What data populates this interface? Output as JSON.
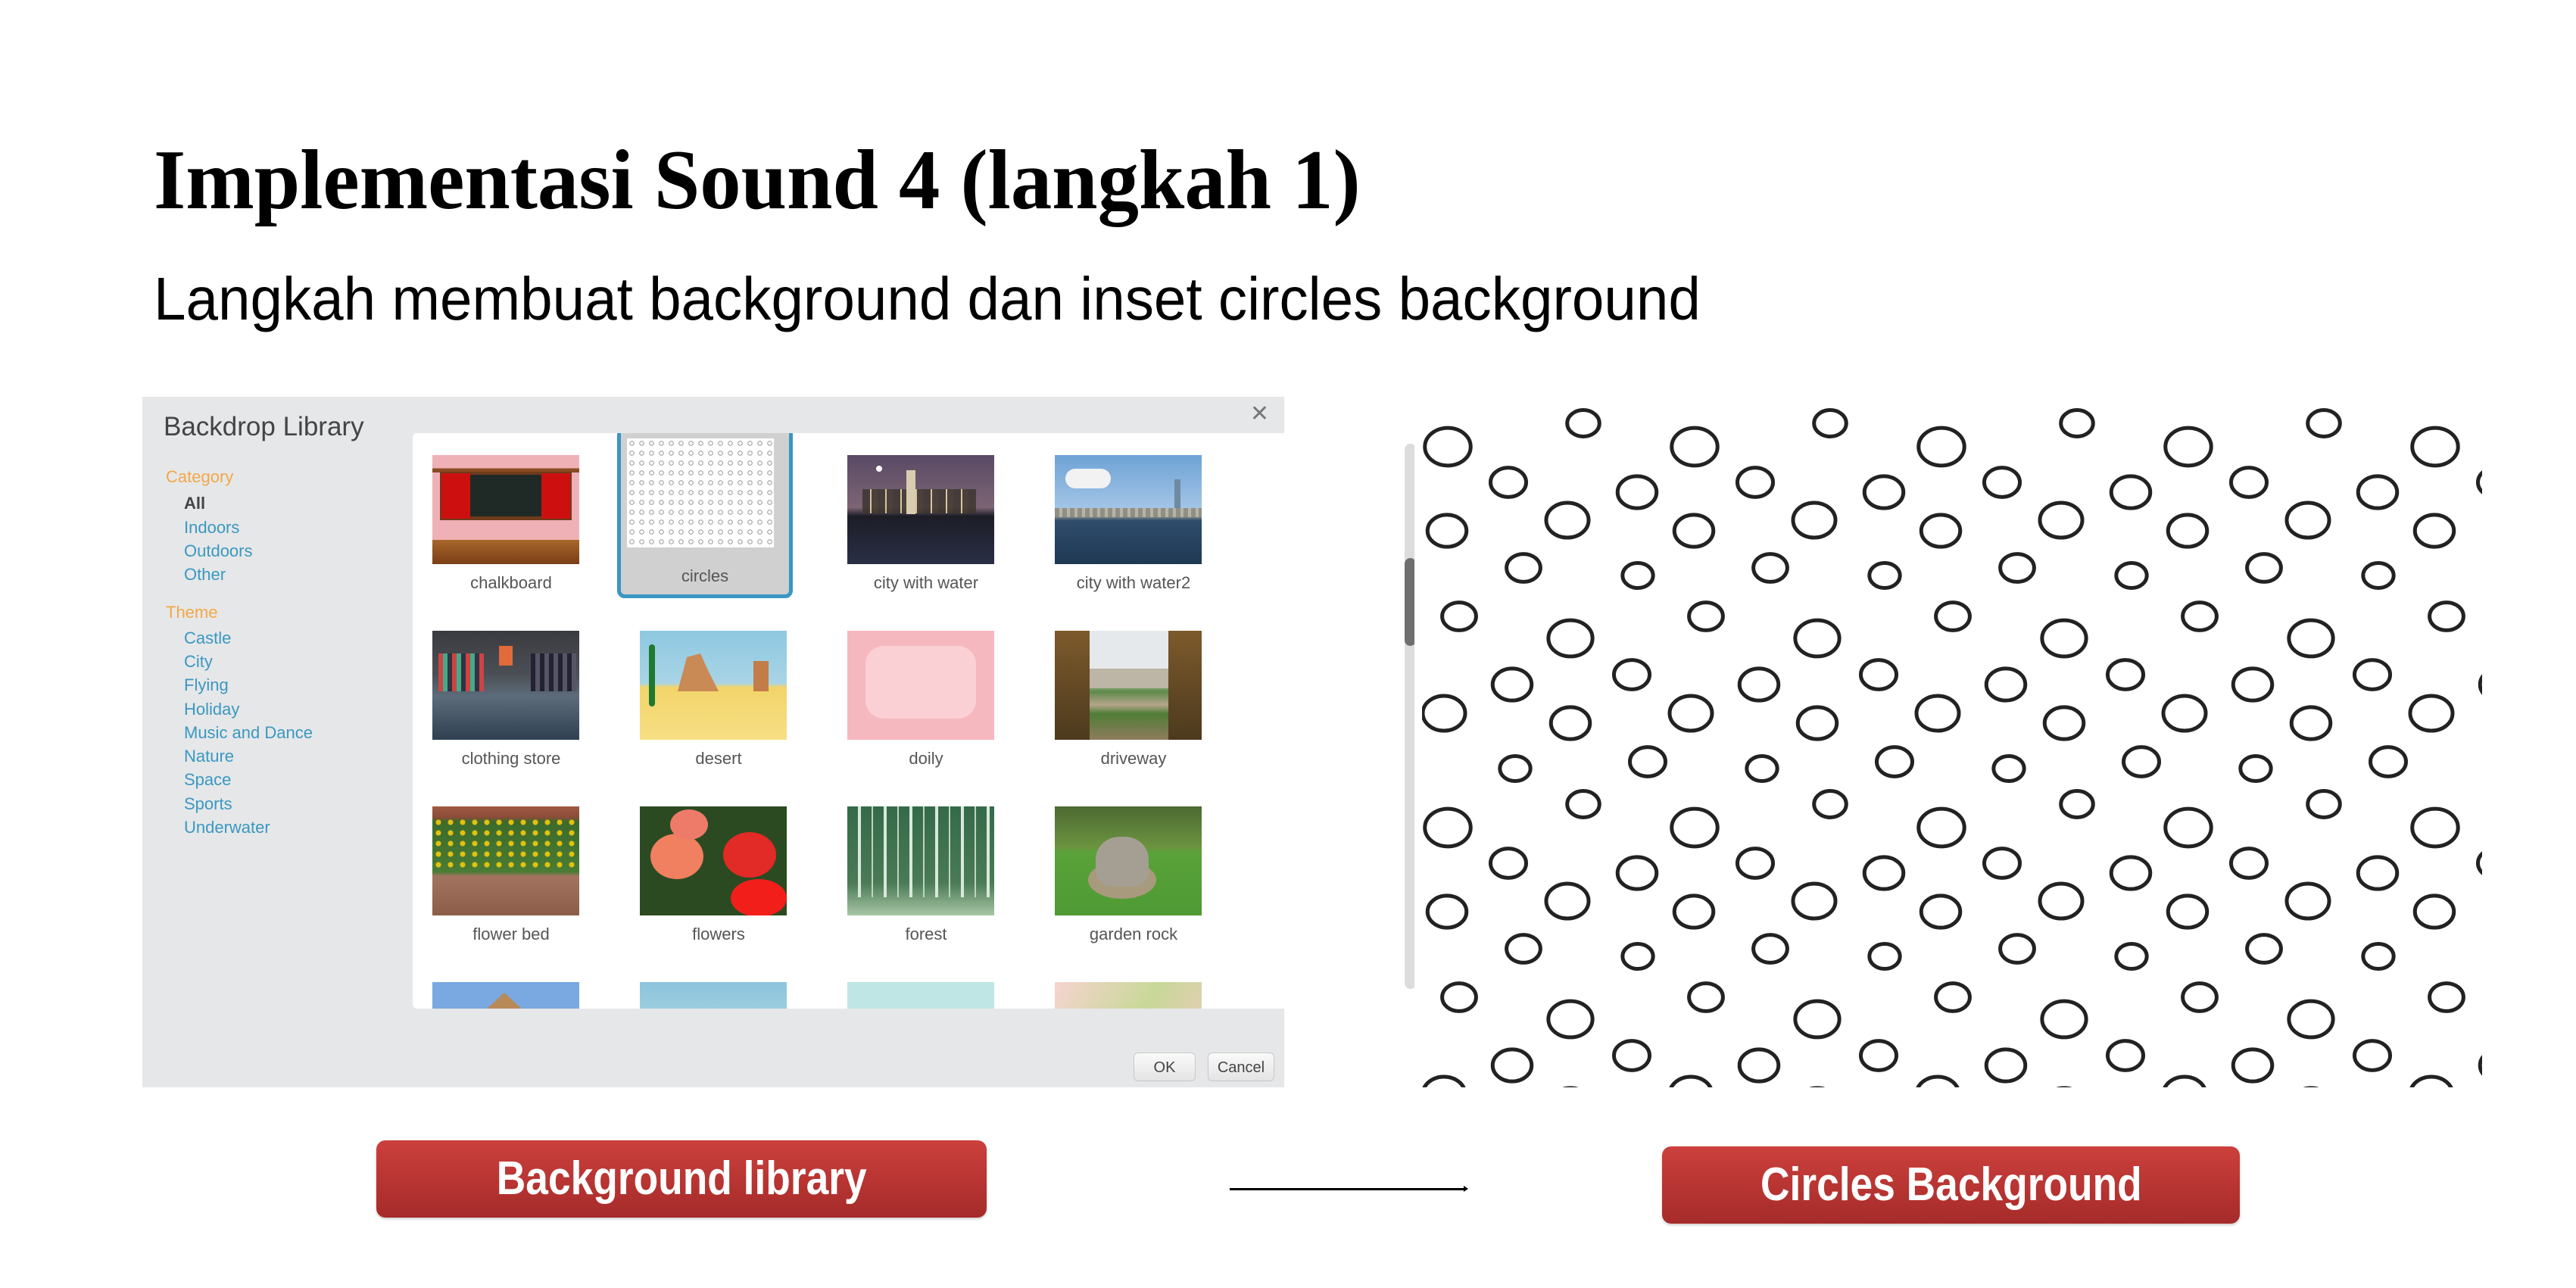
{
  "slide": {
    "title": "Implementasi Sound 4 (langkah 1)",
    "subtitle": "Langkah membuat background dan inset circles background"
  },
  "dialog": {
    "title": "Backdrop Library",
    "close_icon": "close-icon",
    "category_header": "Category",
    "categories": [
      {
        "label": "All",
        "active": true
      },
      {
        "label": "Indoors",
        "active": false
      },
      {
        "label": "Outdoors",
        "active": false
      },
      {
        "label": "Other",
        "active": false
      }
    ],
    "theme_header": "Theme",
    "themes": [
      "Castle",
      "City",
      "Flying",
      "Holiday",
      "Music and Dance",
      "Nature",
      "Space",
      "Sports",
      "Underwater"
    ],
    "backdrops": [
      {
        "name": "chalkboard",
        "selected": false
      },
      {
        "name": "circles",
        "selected": true
      },
      {
        "name": "city with water",
        "selected": false
      },
      {
        "name": "city with water2",
        "selected": false
      },
      {
        "name": "clothing store",
        "selected": false
      },
      {
        "name": "desert",
        "selected": false
      },
      {
        "name": "doily",
        "selected": false
      },
      {
        "name": "driveway",
        "selected": false
      },
      {
        "name": "flower bed",
        "selected": false
      },
      {
        "name": "flowers",
        "selected": false
      },
      {
        "name": "forest",
        "selected": false
      },
      {
        "name": "garden rock",
        "selected": false
      },
      {
        "name": "",
        "selected": false
      },
      {
        "name": "",
        "selected": false
      },
      {
        "name": "",
        "selected": false
      },
      {
        "name": "",
        "selected": false
      }
    ],
    "scroll_position": 0.2,
    "ok_label": "OK",
    "cancel_label": "Cancel",
    "colors": {
      "header_orange": "#f2a848",
      "link_blue": "#3a98c2",
      "selected_border": "#3a96c4"
    }
  },
  "captions": {
    "left": "Background library",
    "right": "Circles Background",
    "badge_color": "#b83532"
  }
}
